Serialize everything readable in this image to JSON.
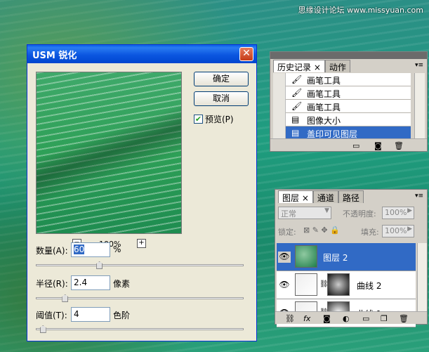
{
  "watermark": "思缘设计论坛 www.missyuan.com",
  "dialog": {
    "title": "USM 锐化",
    "close_glyph": "✕",
    "ok_label": "确定",
    "cancel_label": "取消",
    "preview_label": "预览(P)",
    "preview_checked": true,
    "zoom_minus": "−",
    "zoom_plus": "+",
    "zoom_level": "100%",
    "amount": {
      "label": "数量(A):",
      "value": "60",
      "unit": "%",
      "slider_fraction": 0.3
    },
    "radius": {
      "label": "半径(R):",
      "value": "2.4",
      "unit": "像素",
      "slider_fraction": 0.13
    },
    "threshold": {
      "label": "阈值(T):",
      "value": "4",
      "unit": "色阶",
      "slider_fraction": 0.02
    }
  },
  "history": {
    "tabs": [
      {
        "label": "历史记录 ×"
      },
      {
        "label": "动作"
      }
    ],
    "items": [
      {
        "icon": "brush-icon",
        "label": "画笔工具"
      },
      {
        "icon": "brush-icon",
        "label": "画笔工具"
      },
      {
        "icon": "brush-icon",
        "label": "画笔工具"
      },
      {
        "icon": "image-size-icon",
        "label": "图像大小"
      },
      {
        "icon": "merge-visible-icon",
        "label": "盖印可见图层",
        "selected": true
      }
    ]
  },
  "layers": {
    "tabs": [
      {
        "label": "图层 ×"
      },
      {
        "label": "通道"
      },
      {
        "label": "路径"
      }
    ],
    "blend_mode": "正常",
    "opacity_label": "不透明度:",
    "opacity_value": "100%",
    "lock_label": "锁定:",
    "fill_label": "填充:",
    "fill_value": "100%",
    "items": [
      {
        "name": "图层 2",
        "selected": true
      },
      {
        "name": "曲线 2"
      },
      {
        "name": "曲线 1"
      }
    ],
    "footer_icons": [
      "link-icon",
      "fx-icon",
      "mask-icon",
      "adjustment-icon",
      "folder-icon",
      "new-layer-icon",
      "trash-icon"
    ]
  },
  "colors": {
    "selection": "#316ac5",
    "title_blue": "#0054e3"
  }
}
